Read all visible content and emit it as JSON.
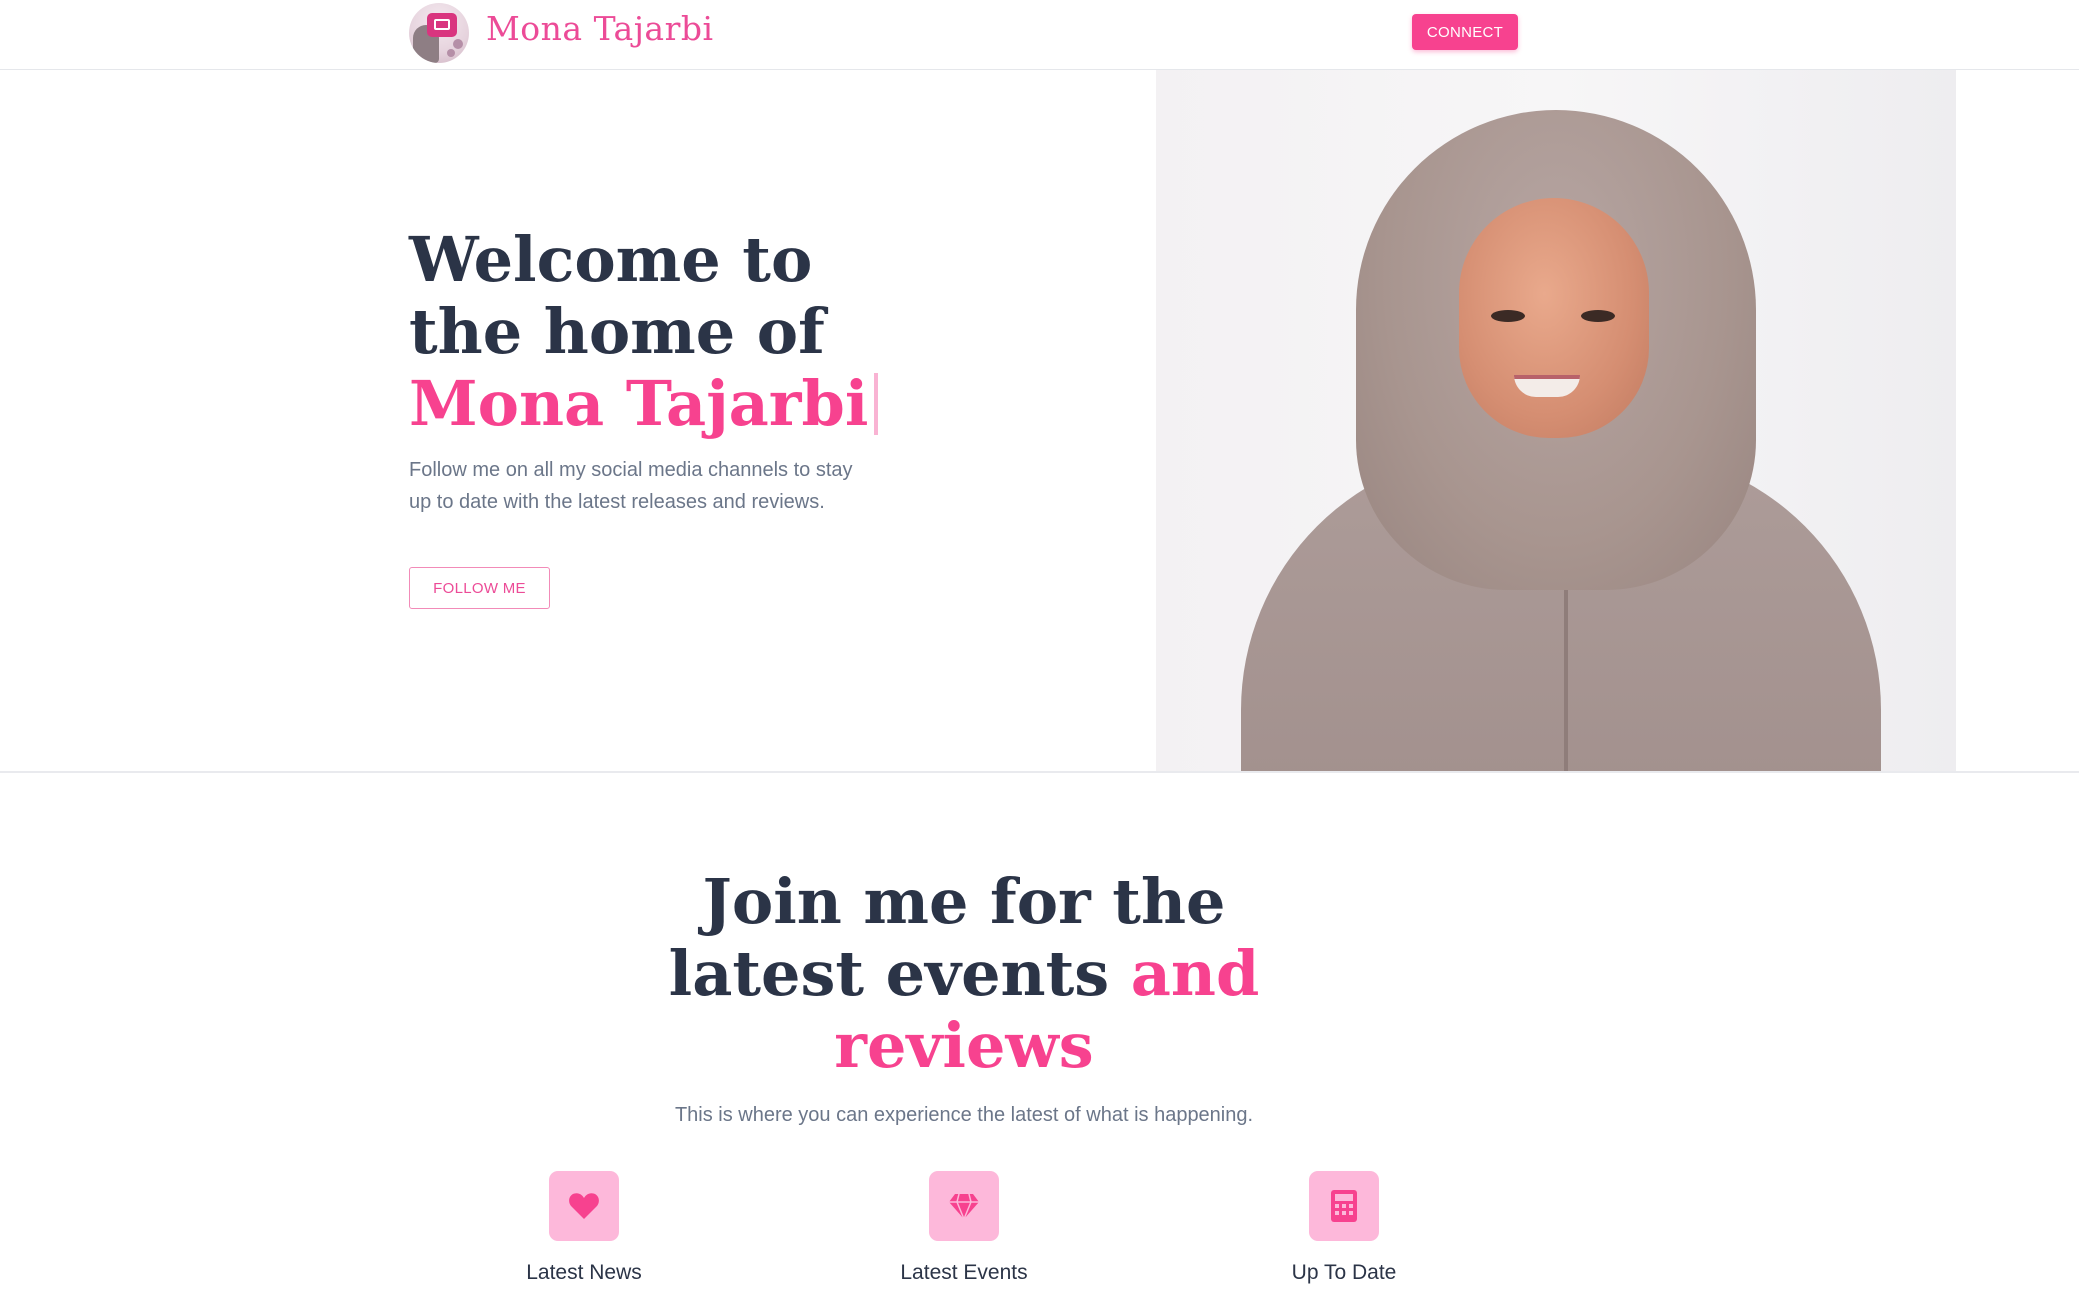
{
  "header": {
    "brand_name": "Mona Tajarbi",
    "connect_label": "CONNECT"
  },
  "hero": {
    "title_line1": "Welcome to",
    "title_line2": "the home of",
    "title_highlight": "Mona Tajarbi",
    "subtitle": "Follow me on all my social media channels to stay up to date with the latest releases and reviews.",
    "follow_label": "FOLLOW ME"
  },
  "events": {
    "title_line1": "Join me for the",
    "title_line2_plain": "latest events ",
    "title_line2_highlight": "and",
    "title_line3_highlight": "reviews",
    "subtitle": "This is where you can experience the latest of what is happening.",
    "features": [
      {
        "label": "Latest News",
        "icon": "heart-icon"
      },
      {
        "label": "Latest Events",
        "icon": "diamond-icon"
      },
      {
        "label": "Up To Date",
        "icon": "calculator-icon"
      }
    ]
  },
  "colors": {
    "accent": "#f7428f",
    "heading": "#2b3447",
    "muted": "#6b7689",
    "icon_bg": "#fdb8da"
  }
}
